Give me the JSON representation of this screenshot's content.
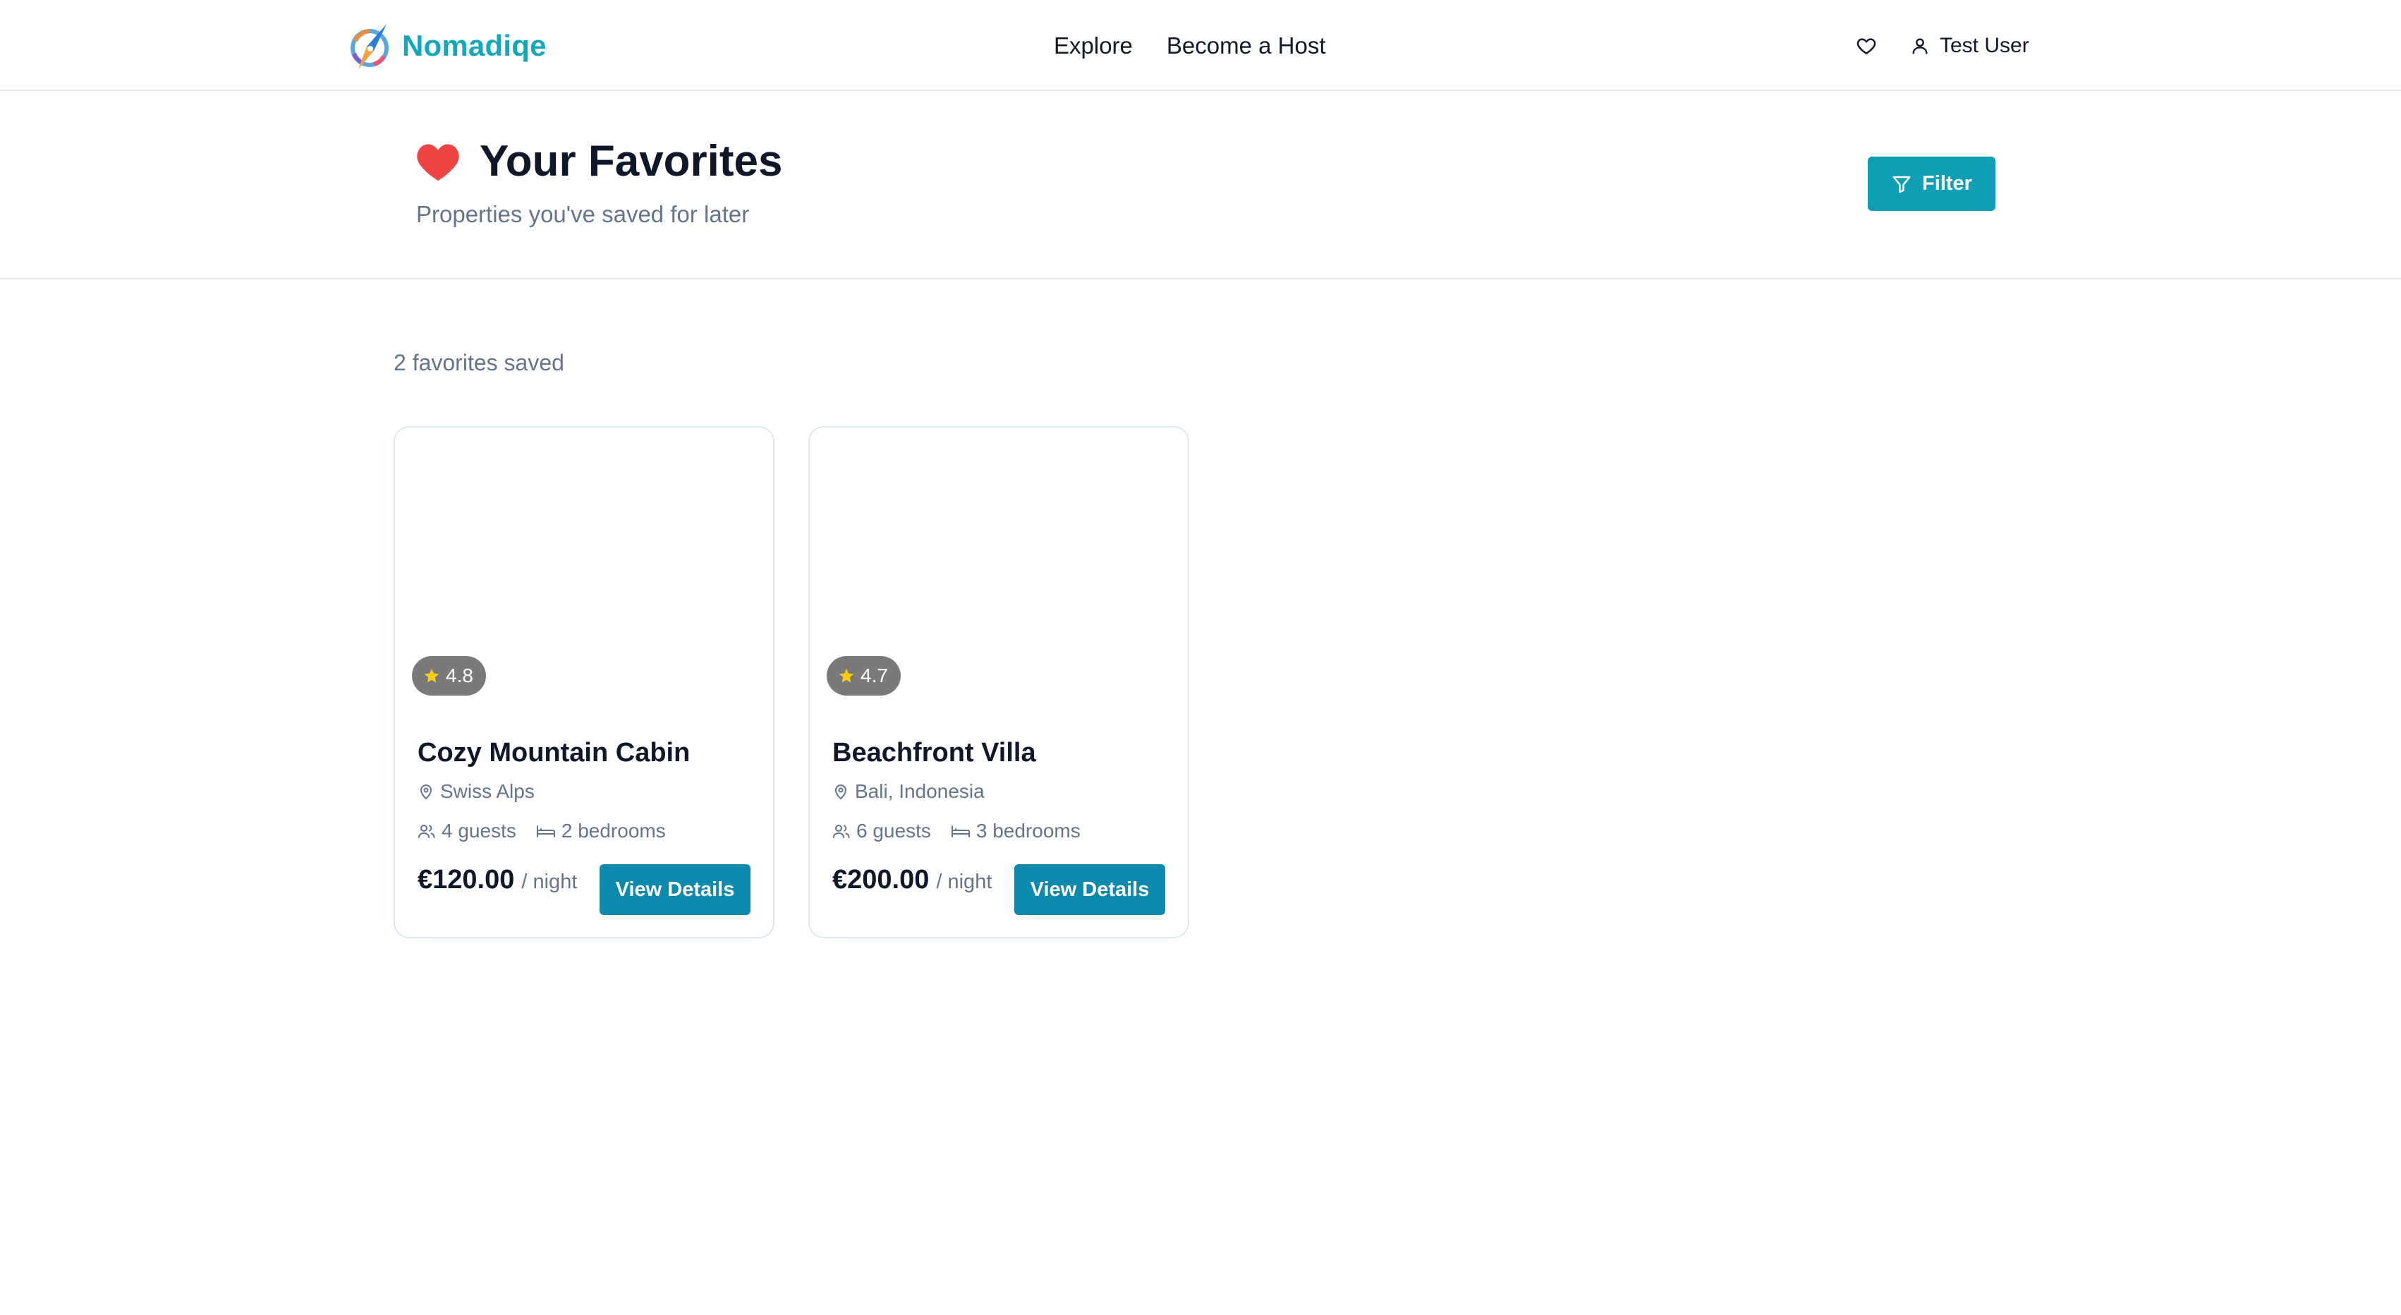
{
  "nav": {
    "brand": "Nomadiqe",
    "links": [
      "Explore",
      "Become a Host"
    ],
    "user_name": "Test User",
    "brand_color": "#12a9bd"
  },
  "header": {
    "title": "Your Favorites",
    "subtitle": "Properties you've saved for later",
    "filter_label": "Filter",
    "accent_color": "#0e9fb6"
  },
  "main": {
    "count_text": "2 favorites saved",
    "cards": [
      {
        "rating": "4.8",
        "title": "Cozy Mountain Cabin",
        "location": "Swiss Alps",
        "guests": "4 guests",
        "bedrooms": "2 bedrooms",
        "price": "€120.00",
        "per_night": "/ night",
        "button": "View Details"
      },
      {
        "rating": "4.7",
        "title": "Beachfront Villa",
        "location": "Bali, Indonesia",
        "guests": "6 guests",
        "bedrooms": "3 bedrooms",
        "price": "€200.00",
        "per_night": "/ night",
        "button": "View Details"
      }
    ]
  },
  "icons": {
    "logo": "compass-logo-icon",
    "title": "heart-icon",
    "nav_favorites": "heart-outline-icon",
    "user": "user-icon",
    "filter": "filter-icon",
    "rating": "star-icon",
    "location": "map-pin-icon",
    "guests": "users-icon",
    "bedrooms": "bed-icon"
  }
}
